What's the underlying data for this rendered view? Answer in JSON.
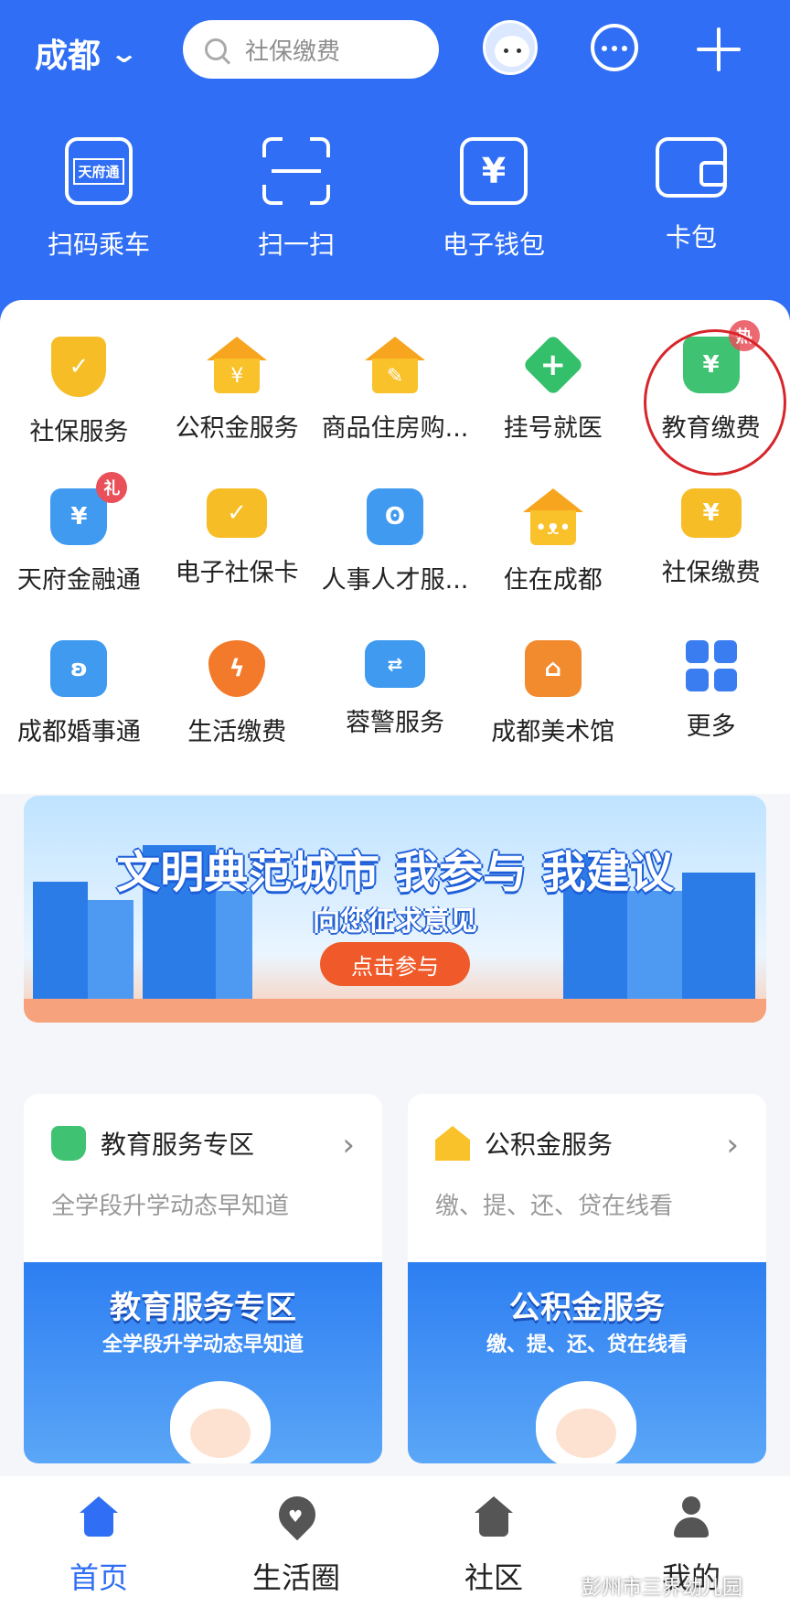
{
  "header": {
    "city": "成都",
    "search_placeholder": "社保缴费",
    "icons": {
      "city_dropdown": "chevron-down-icon",
      "search": "search-icon",
      "avatar": "mascot-avatar",
      "message": "message-bubble-icon",
      "add": "plus-icon"
    }
  },
  "quick_actions": [
    {
      "label": "扫码乘车",
      "icon": "tianfutong-ride-icon",
      "icon_text": "天府通"
    },
    {
      "label": "扫一扫",
      "icon": "scan-icon"
    },
    {
      "label": "电子钱包",
      "icon": "yuan-wallet-icon",
      "icon_text": "¥"
    },
    {
      "label": "卡包",
      "icon": "card-wallet-icon"
    }
  ],
  "services": [
    {
      "label": "社保服务",
      "icon": "shield-check-icon",
      "color": "#f7bd27"
    },
    {
      "label": "公积金服务",
      "icon": "house-yuan-icon",
      "color": "#f9c22b",
      "glyph": "¥"
    },
    {
      "label": "商品住房购...",
      "icon": "house-pen-icon",
      "color": "#f9c22b"
    },
    {
      "label": "挂号就医",
      "icon": "medical-cross-icon",
      "color": "#34c06a",
      "glyph": "+"
    },
    {
      "label": "教育缴费",
      "icon": "education-bag-icon",
      "color": "#3fc272",
      "glyph": "¥",
      "badge": "热",
      "highlighted": true
    },
    {
      "label": "天府金融通",
      "icon": "money-bag-icon",
      "color": "#3f9af0",
      "glyph": "¥",
      "badge": "礼"
    },
    {
      "label": "电子社保卡",
      "icon": "social-card-icon",
      "color": "#f7bd27"
    },
    {
      "label": "人事人才服...",
      "icon": "talent-service-icon",
      "color": "#3f9af0"
    },
    {
      "label": "住在成都",
      "icon": "house-panda-icon",
      "color": "#f7bd27"
    },
    {
      "label": "社保缴费",
      "icon": "hand-coin-icon",
      "color": "#f7bd27"
    },
    {
      "label": "成都婚事通",
      "icon": "marriage-icon",
      "color": "#3f9af0"
    },
    {
      "label": "生活缴费",
      "icon": "lightning-drop-icon",
      "color": "#f27a2a"
    },
    {
      "label": "蓉警服务",
      "icon": "police-id-icon",
      "color": "#3f9af0"
    },
    {
      "label": "成都美术馆",
      "icon": "museum-icon",
      "color": "#f28a2e"
    },
    {
      "label": "更多",
      "icon": "grid-more-icon",
      "color": "#3a7df0"
    }
  ],
  "banner": {
    "title": "文明典范城市 我参与 我建议",
    "subtitle": "向您征求意见",
    "button": "点击参与"
  },
  "cards": [
    {
      "title": "教育服务专区",
      "subtitle": "全学段升学动态早知道",
      "image_title": "教育服务专区",
      "image_subtitle": "全学段升学动态早知道",
      "icon": "education-bag-icon",
      "color": "#3fc272"
    },
    {
      "title": "公积金服务",
      "subtitle": "缴、提、还、贷在线看",
      "image_title": "公积金服务",
      "image_subtitle": "缴、提、还、贷在线看",
      "icon": "house-yuan-icon",
      "color": "#f9c22b"
    }
  ],
  "nav": [
    {
      "label": "首页",
      "icon": "home-icon",
      "active": true
    },
    {
      "label": "生活圈",
      "icon": "heart-pin-icon",
      "active": false
    },
    {
      "label": "社区",
      "icon": "community-house-icon",
      "active": false
    },
    {
      "label": "我的",
      "icon": "person-icon",
      "active": false
    }
  ],
  "watermark": "彭州市三界幼儿园",
  "colors": {
    "brand_blue": "#2f6ef5",
    "highlight_red": "#d6262b"
  }
}
